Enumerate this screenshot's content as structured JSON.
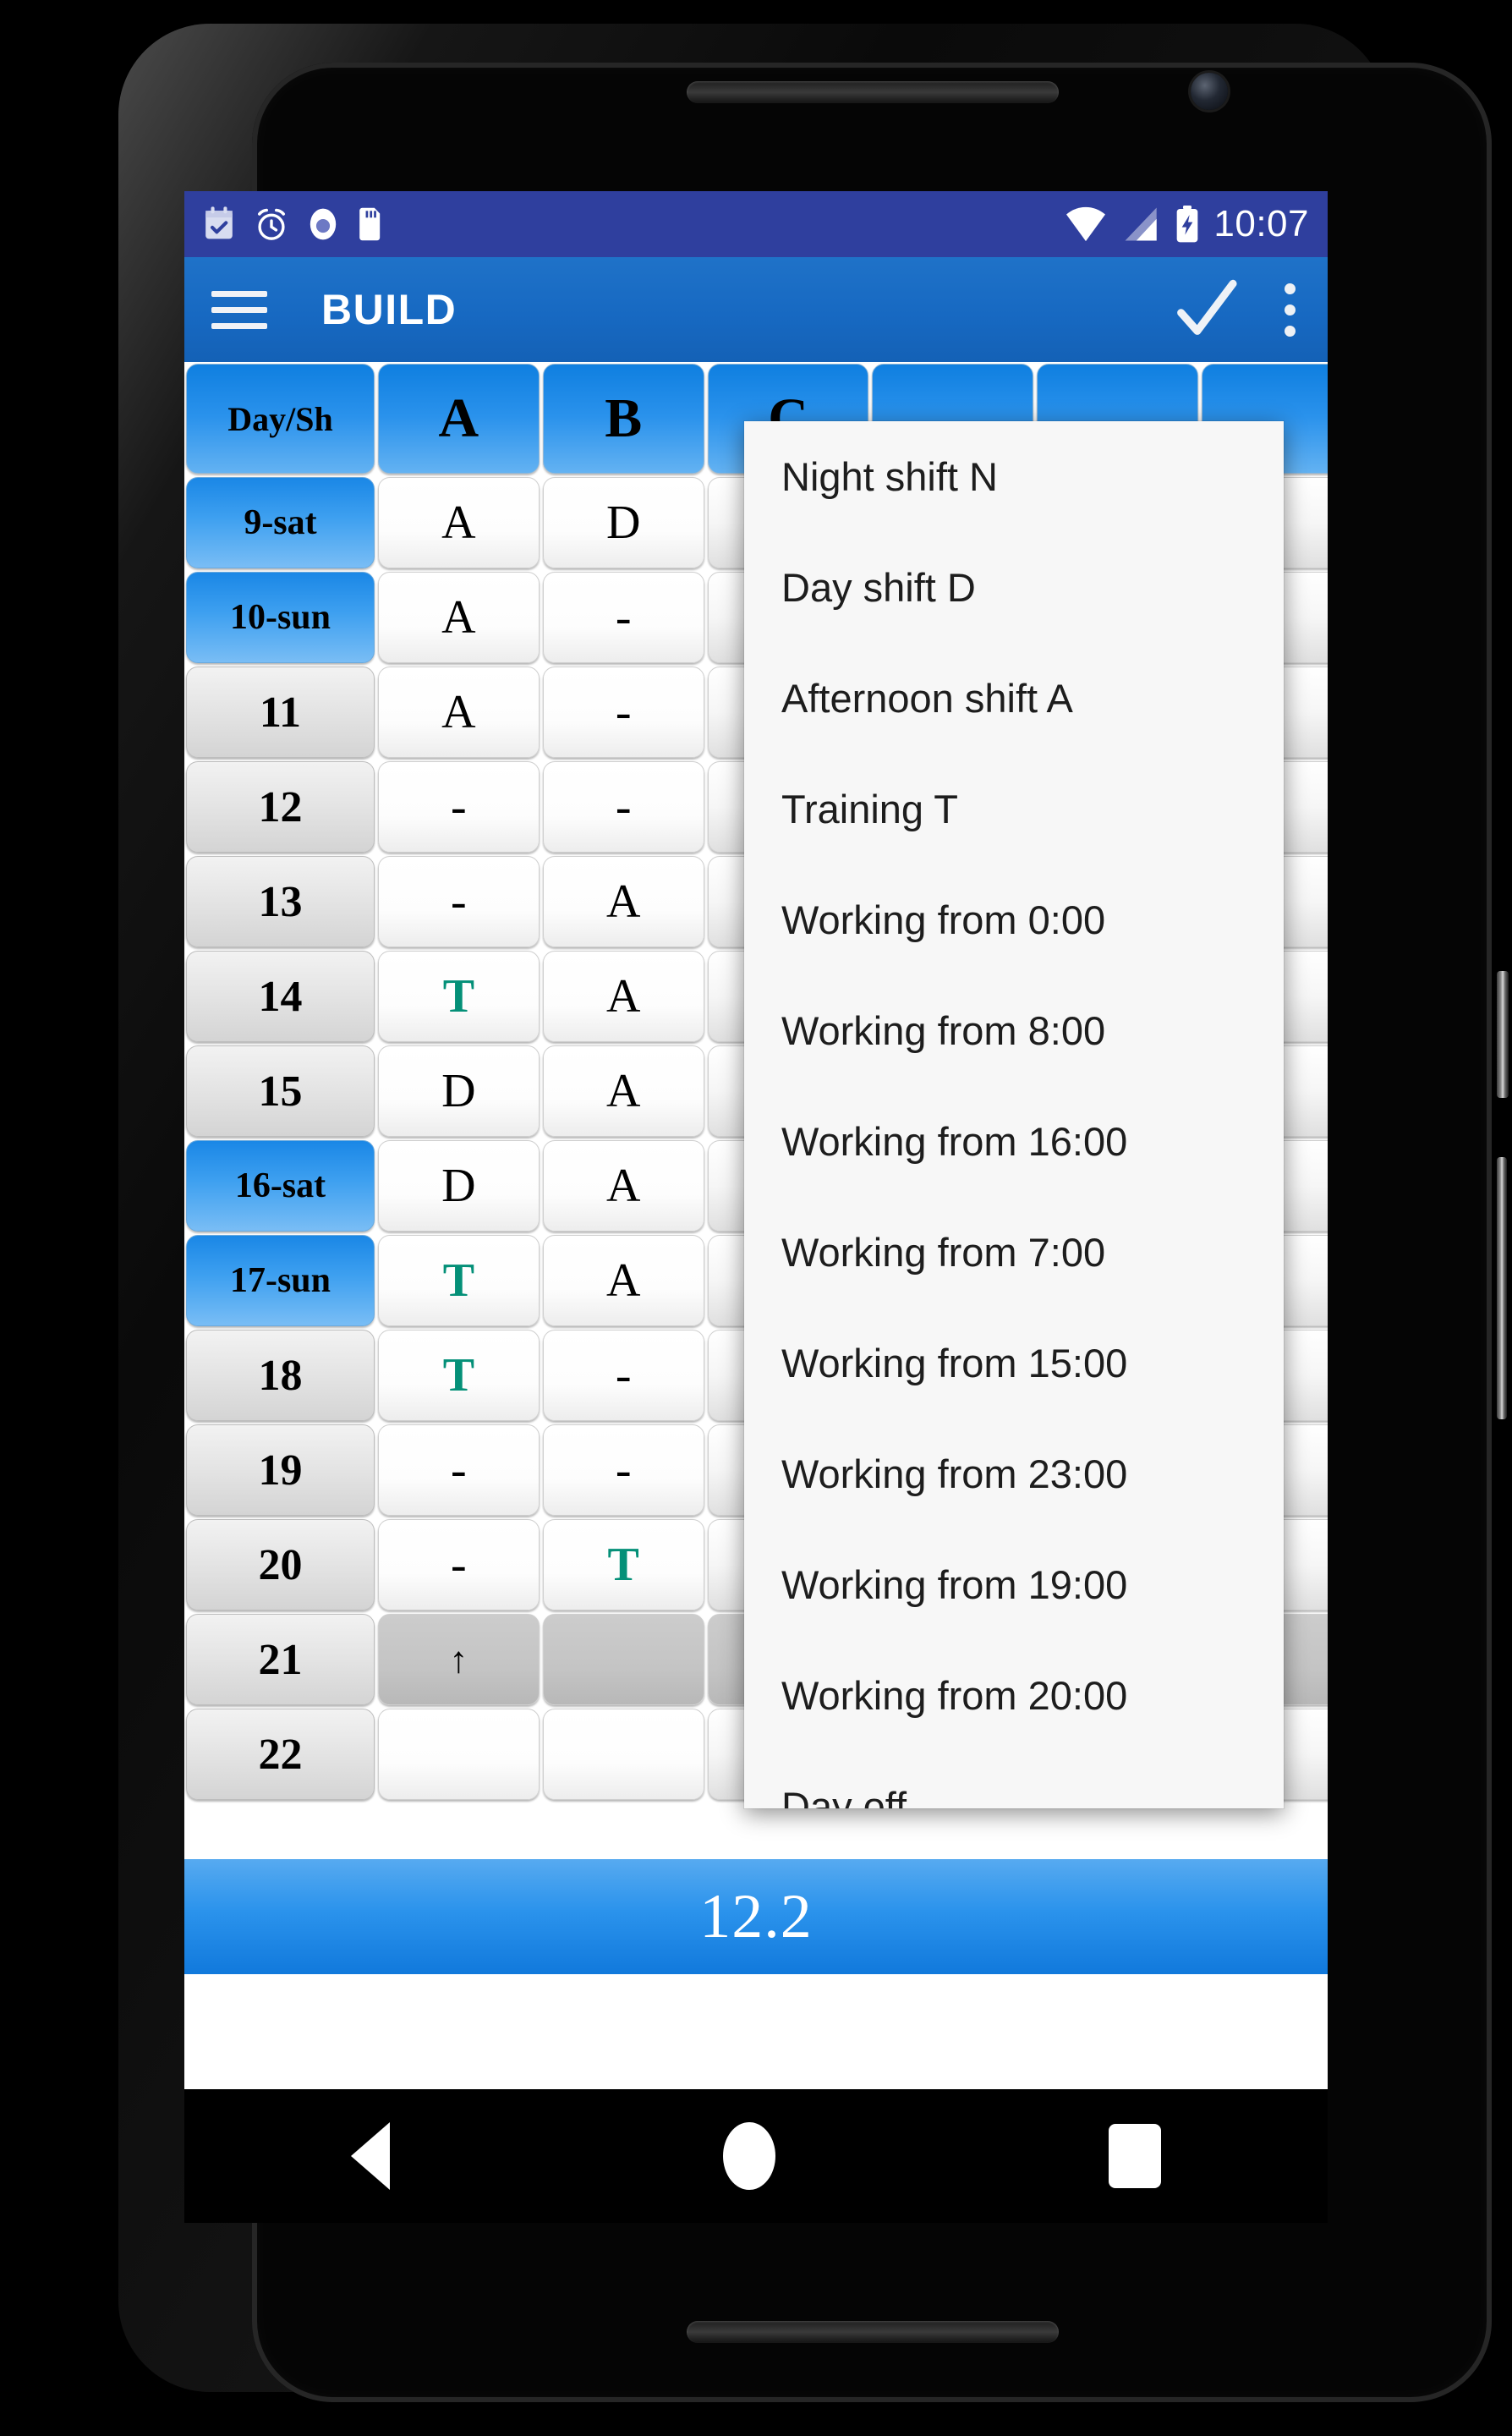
{
  "status_bar": {
    "clock": "10:07",
    "left_icons": [
      "calendar-check-icon",
      "alarm-clock-icon",
      "record-circle-icon",
      "sd-card-icon"
    ],
    "right_icons": [
      "wifi-icon",
      "cell-signal-icon",
      "battery-charging-icon"
    ],
    "background_color": "#2f3f9e"
  },
  "app_bar": {
    "title": "BUILD",
    "menu_icon": "hamburger-icon",
    "confirm_icon": "check-icon",
    "overflow_icon": "more-vert-icon",
    "background_color": "#1769c2"
  },
  "table": {
    "headers": [
      "Day/Sh",
      "A",
      "B",
      "C"
    ],
    "rows": [
      {
        "day": "9-sat",
        "weekend": true,
        "values": [
          "A",
          "D",
          ""
        ]
      },
      {
        "day": "10-sun",
        "weekend": true,
        "values": [
          "A",
          "-",
          ""
        ]
      },
      {
        "day": "11",
        "weekend": false,
        "values": [
          "A",
          "-",
          ""
        ]
      },
      {
        "day": "12",
        "weekend": false,
        "values": [
          "-",
          "-",
          ""
        ]
      },
      {
        "day": "13",
        "weekend": false,
        "values": [
          "-",
          "A",
          ""
        ]
      },
      {
        "day": "14",
        "weekend": false,
        "values": [
          "T",
          "A",
          ""
        ]
      },
      {
        "day": "15",
        "weekend": false,
        "values": [
          "D",
          "A",
          ""
        ]
      },
      {
        "day": "16-sat",
        "weekend": true,
        "values": [
          "D",
          "A",
          ""
        ]
      },
      {
        "day": "17-sun",
        "weekend": true,
        "values": [
          "T",
          "A",
          ""
        ]
      },
      {
        "day": "18",
        "weekend": false,
        "values": [
          "T",
          "-",
          ""
        ]
      },
      {
        "day": "19",
        "weekend": false,
        "values": [
          "-",
          "-",
          ""
        ]
      },
      {
        "day": "20",
        "weekend": false,
        "values": [
          "-",
          "T",
          ""
        ]
      },
      {
        "day": "21",
        "weekend": false,
        "values": [
          "↑",
          "",
          ""
        ]
      },
      {
        "day": "22",
        "weekend": false,
        "values": [
          "",
          "",
          ""
        ]
      }
    ],
    "teal_value": "T",
    "teal_color": "#049078",
    "weekend_color": "#3ea0f0"
  },
  "total_bar": {
    "value": "12.2",
    "background_color": "#2b93ec"
  },
  "shift_menu": {
    "items": [
      "Night shift N",
      "Day shift D",
      "Afternoon shift A",
      "Training T",
      "Working from 0:00",
      "Working from 8:00",
      "Working from 16:00",
      "Working from 7:00",
      "Working from 15:00",
      "Working from 23:00",
      "Working from 19:00",
      "Working from 20:00",
      "Day off"
    ]
  },
  "nav_bar": {
    "back_icon": "back-triangle-icon",
    "home_icon": "home-circle-icon",
    "recents_icon": "recents-square-icon"
  }
}
